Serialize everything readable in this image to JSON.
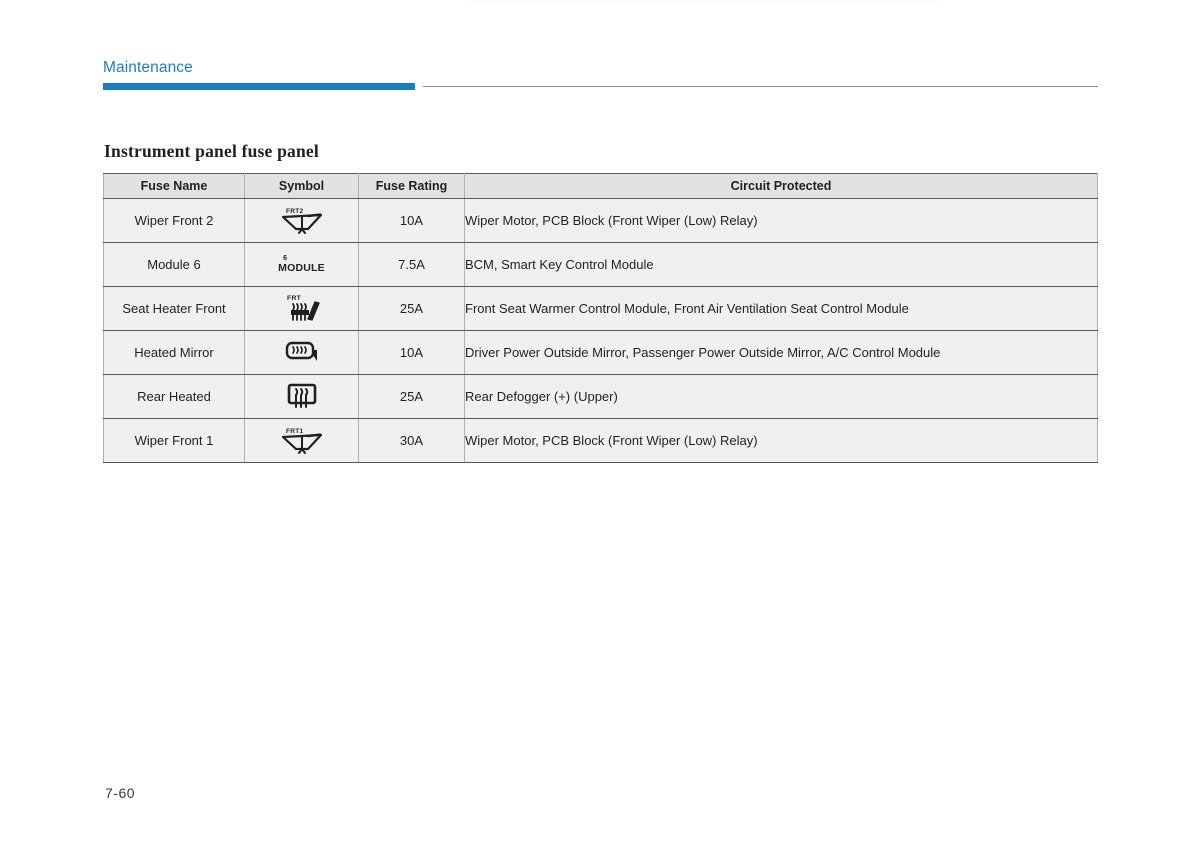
{
  "document": {
    "chapter_title": "Maintenance",
    "section_heading": "Instrument panel fuse panel",
    "page_number": "7-60",
    "accent_color": "#1a7fc1",
    "rule_color": "#8c8c8c"
  },
  "table": {
    "columns": [
      {
        "key": "fuse_name",
        "label": "Fuse Name"
      },
      {
        "key": "symbol",
        "label": "Symbol"
      },
      {
        "key": "fuse_rating",
        "label": "Fuse Rating"
      },
      {
        "key": "circuit_protected",
        "label": "Circuit Protected"
      }
    ],
    "rows": [
      {
        "fuse_name": "Wiper Front 2",
        "symbol_icon": "wiper-front-2-icon",
        "symbol_label": "FRT2",
        "fuse_rating": "10A",
        "circuit_protected": "Wiper Motor, PCB Block (Front Wiper (Low) Relay)"
      },
      {
        "fuse_name": "Module 6",
        "symbol_icon": "module-6-icon",
        "symbol_label": "MODULE",
        "symbol_superscript": "6",
        "fuse_rating": "7.5A",
        "circuit_protected": "BCM, Smart Key Control Module"
      },
      {
        "fuse_name": "Seat Heater Front",
        "symbol_icon": "seat-heater-front-icon",
        "symbol_label": "FRT",
        "fuse_rating": "25A",
        "circuit_protected": "Front Seat Warmer Control Module, Front Air Ventilation Seat Control Module"
      },
      {
        "fuse_name": "Heated Mirror",
        "symbol_icon": "heated-mirror-icon",
        "symbol_label": "",
        "fuse_rating": "10A",
        "circuit_protected": "Driver Power Outside Mirror, Passenger Power Outside Mirror, A/C Control Module"
      },
      {
        "fuse_name": "Rear Heated",
        "symbol_icon": "rear-defogger-icon",
        "symbol_label": "",
        "fuse_rating": "25A",
        "circuit_protected": "Rear Defogger (+) (Upper)"
      },
      {
        "fuse_name": "Wiper Front 1",
        "symbol_icon": "wiper-front-1-icon",
        "symbol_label": "FRT1",
        "fuse_rating": "30A",
        "circuit_protected": "Wiper Motor, PCB Block (Front Wiper (Low) Relay)"
      }
    ]
  }
}
